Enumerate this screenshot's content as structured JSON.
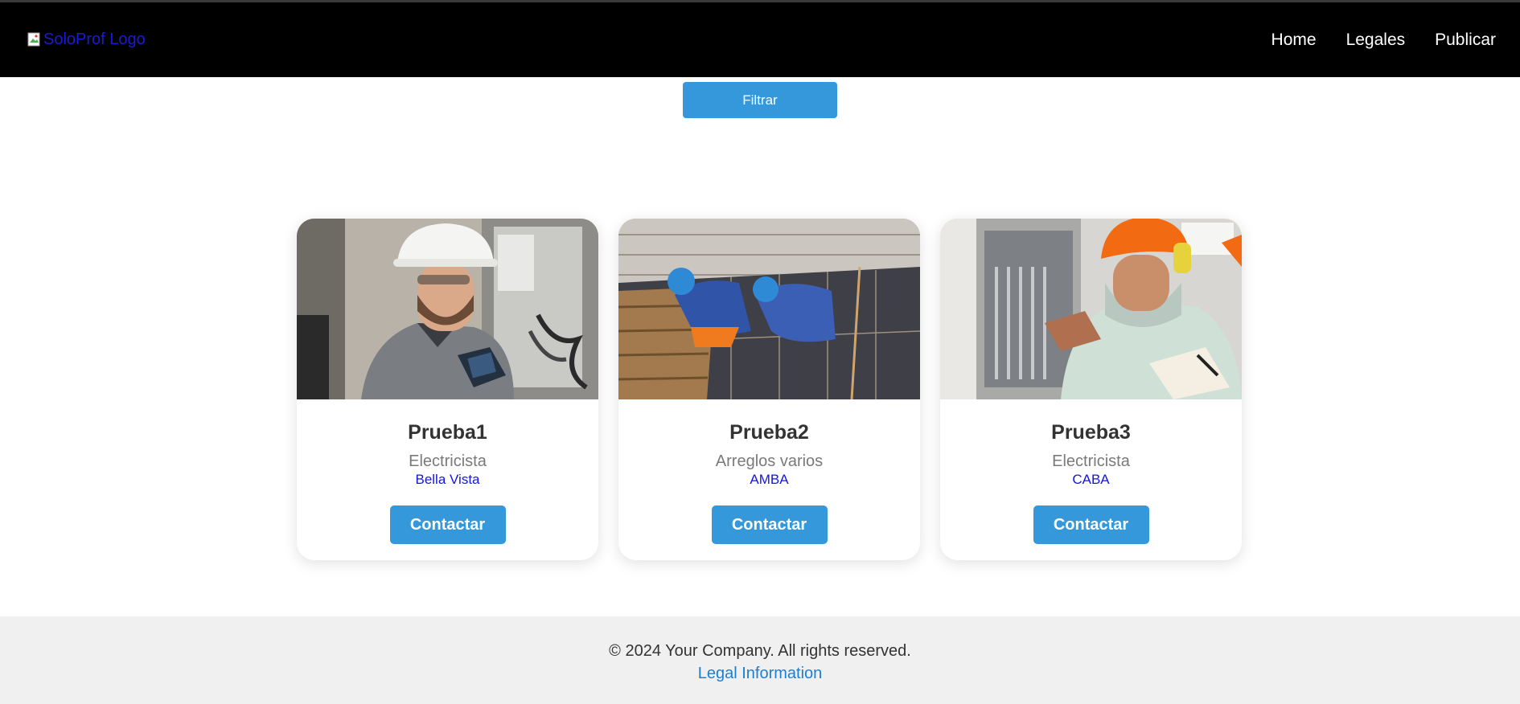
{
  "header": {
    "logo_alt": "SoloProf Logo",
    "nav": [
      "Home",
      "Legales",
      "Publicar"
    ]
  },
  "filter": {
    "label": "Filtrar"
  },
  "cards": [
    {
      "name": "Prueba1",
      "role": "Electricista",
      "location": "Bella Vista",
      "button": "Contactar",
      "image": "electrician-with-tablet-photo"
    },
    {
      "name": "Prueba2",
      "role": "Arreglos varios",
      "location": "AMBA",
      "button": "Contactar",
      "image": "construction-workers-photo"
    },
    {
      "name": "Prueba3",
      "role": "Electricista",
      "location": "CABA",
      "button": "Contactar",
      "image": "electrician-orange-helmet-photo"
    }
  ],
  "footer": {
    "copyright": "© 2024 Your Company. All rights reserved.",
    "legal_link": "Legal Information"
  },
  "colors": {
    "navbar": "#000000",
    "accent": "#3498db",
    "location_link": "#1515e0",
    "footer_bg": "#f0f0f0"
  }
}
